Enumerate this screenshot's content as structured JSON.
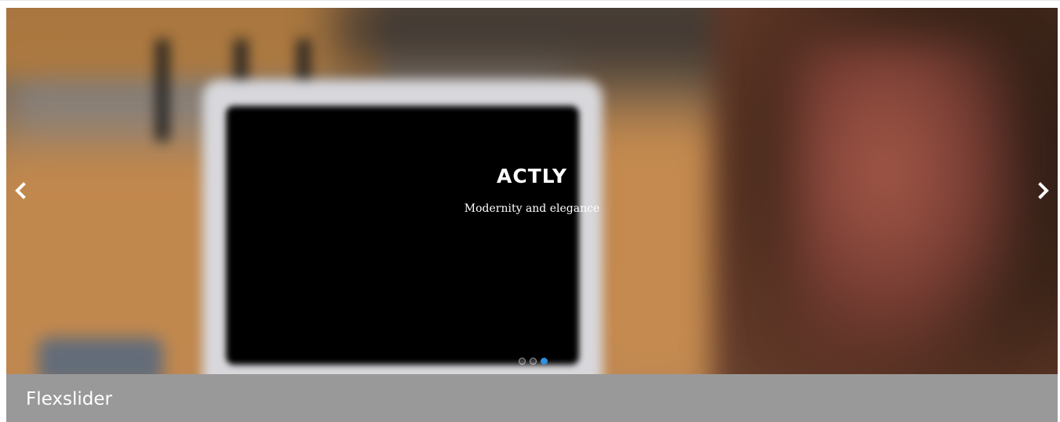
{
  "slider": {
    "caption_title": "ACTLY",
    "caption_subtitle": "Modernity and elegance",
    "prev_icon": "chevron-left-icon",
    "next_icon": "chevron-right-icon",
    "dot_count": 3,
    "active_dot_index": 2,
    "active_dot_color": "#2f8fe0"
  },
  "footer": {
    "title": "Flexslider",
    "background_color": "#999999"
  }
}
